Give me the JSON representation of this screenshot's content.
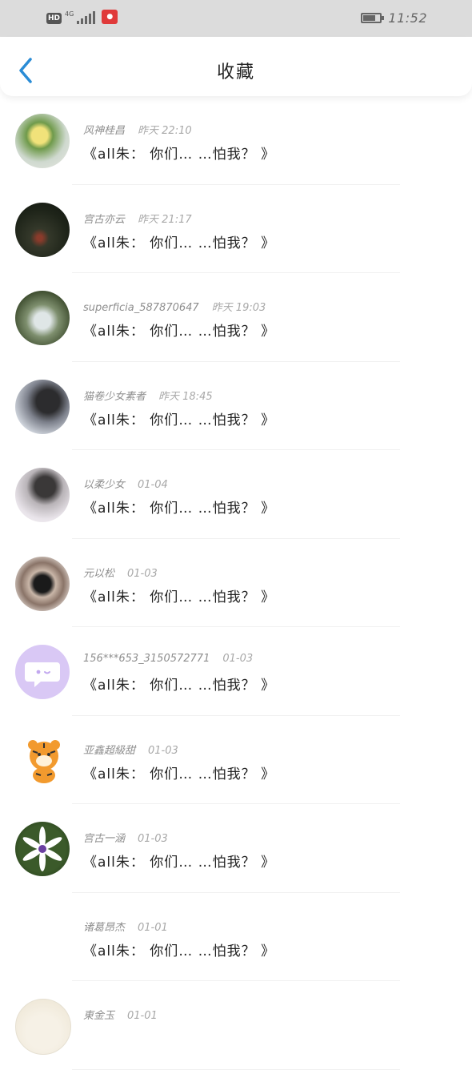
{
  "status_bar": {
    "hd": "HD",
    "network": "4G",
    "time": "11:52",
    "battery_level": 0.75
  },
  "header": {
    "title": "收藏"
  },
  "items": [
    {
      "name": "风神桂昌",
      "time": "昨天 22:10",
      "title": "《all朱： 你们… …怕我？ 》",
      "avatar": "photo-flowers"
    },
    {
      "name": "宫古亦云",
      "time": "昨天 21:17",
      "title": "《all朱： 你们… …怕我？ 》",
      "avatar": "photo-forest"
    },
    {
      "name": "superficia_587870647",
      "time": "昨天 19:03",
      "title": "《all朱： 你们… …怕我？ 》",
      "avatar": "photo-person"
    },
    {
      "name": "猫卷少女素者",
      "time": "昨天 18:45",
      "title": "《all朱： 你们… …怕我？ 》",
      "avatar": "photo-girl"
    },
    {
      "name": "以柔少女",
      "time": "01-04",
      "title": "《all朱： 你们… …怕我？ 》",
      "avatar": "anime-couple"
    },
    {
      "name": "元以松",
      "time": "01-03",
      "title": "《all朱： 你们… …怕我？ 》",
      "avatar": "photo-collage"
    },
    {
      "name": "156***653_3150572771",
      "time": "01-03",
      "title": "《all朱： 你们… …怕我？ 》",
      "avatar": "default-chat-avatar"
    },
    {
      "name": "亚鑫超級甜",
      "time": "01-03",
      "title": "《all朱： 你们… …怕我？ 》",
      "avatar": "cartoon-tiger"
    },
    {
      "name": "宫古一涵",
      "time": "01-03",
      "title": "《all朱： 你们… …怕我？ 》",
      "avatar": "photo-lily"
    },
    {
      "name": "诸葛昂杰",
      "time": "01-01",
      "title": "《all朱： 你们… …怕我？ 》",
      "avatar": "empty"
    },
    {
      "name": "東金玉",
      "time": "01-01",
      "title": "",
      "avatar": "sketch"
    }
  ],
  "colors": {
    "accent": "#2a8cd6",
    "status_bar": "#dcdcdc"
  }
}
